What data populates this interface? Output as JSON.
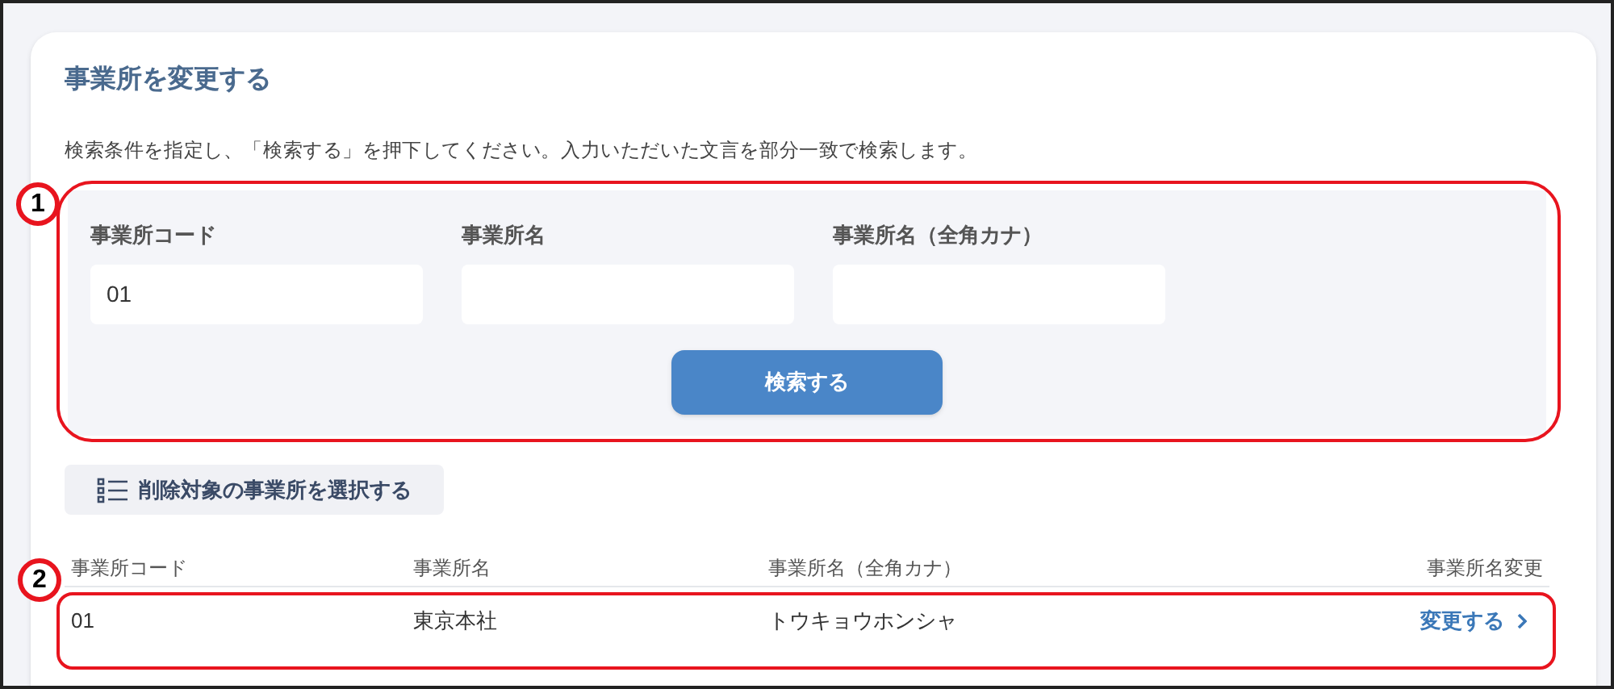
{
  "title": "事業所を変更する",
  "description": "検索条件を指定し、「検索する」を押下してください。入力いただいた文言を部分一致で検索します。",
  "search_form": {
    "fields": [
      {
        "label": "事業所コード",
        "value": "01"
      },
      {
        "label": "事業所名"
      },
      {
        "label": "事業所名（全角カナ）"
      }
    ],
    "search_button": "検索する"
  },
  "select_delete_button": "削除対象の事業所を選択する",
  "table": {
    "columns": [
      "事業所コード",
      "事業所名",
      "事業所名（全角カナ）",
      "事業所名変更"
    ],
    "rows": [
      {
        "code": "01",
        "name": "東京本社",
        "kana": "トウキョウホンシャ",
        "action": "変更する"
      }
    ]
  },
  "annotations": [
    {
      "number": "1"
    },
    {
      "number": "2"
    }
  ]
}
